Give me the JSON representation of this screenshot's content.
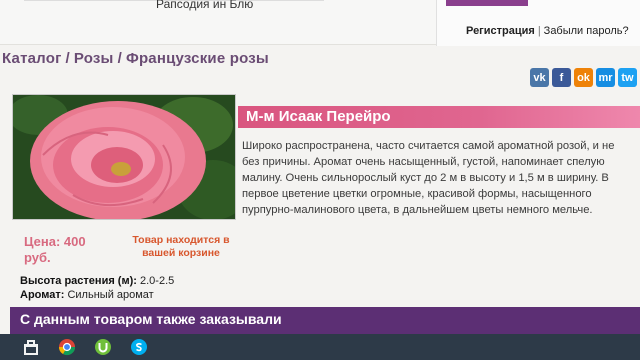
{
  "header": {
    "top_link": "Рапсодия ин Блю",
    "auth": {
      "register": "Регистрация",
      "separator": "|",
      "forgot": "Забыли пароль?"
    }
  },
  "breadcrumb": {
    "items": [
      "Каталог",
      "Розы",
      "Французские розы"
    ],
    "separator": "/"
  },
  "social": {
    "buttons": [
      {
        "label": "vk",
        "icon": "vk-icon",
        "color": "#4a76a8"
      },
      {
        "label": "f",
        "icon": "facebook-icon",
        "color": "#3b5998"
      },
      {
        "label": "ok",
        "icon": "odnoklassniki-icon",
        "color": "#ee8208"
      },
      {
        "label": "mr",
        "icon": "mailru-icon",
        "color": "#168de2"
      },
      {
        "label": "tw",
        "icon": "twitter-icon",
        "color": "#1da1f2"
      }
    ]
  },
  "product": {
    "name": "М-м Исаак Перейро",
    "description": "Широко распространена, часто считается самой ароматной розой, и не без причины. Аромат очень насыщенный, густой, напоминает спелую малину. Очень сильнорослый куст до 2 м в высоту и 1,5 м в ширину. В первое цветение цветки огромные, красивой формы, насыщенного пурпурно-малинового цвета, в дальнейшем цветы немного мельче.",
    "price": "Цена: 400 руб.",
    "in_cart": "Товар находится в вашей корзине",
    "height_label": "Высота растения (м):",
    "height_value": "2.0-2.5",
    "aroma_label": "Аромат:",
    "aroma_value": "Сильный аромат"
  },
  "also_ordered": {
    "title": "С данным товаром также заказывали"
  },
  "colors": {
    "title_bar": "#d9557f",
    "breadcrumb": "#6a4c74",
    "price": "#d86a80",
    "in_cart": "#d8572e",
    "also_bar": "#5c2f74"
  },
  "taskbar": {
    "icons": [
      "shopping-bag-icon",
      "chrome-icon",
      "utorrent-icon",
      "skype-icon"
    ]
  }
}
